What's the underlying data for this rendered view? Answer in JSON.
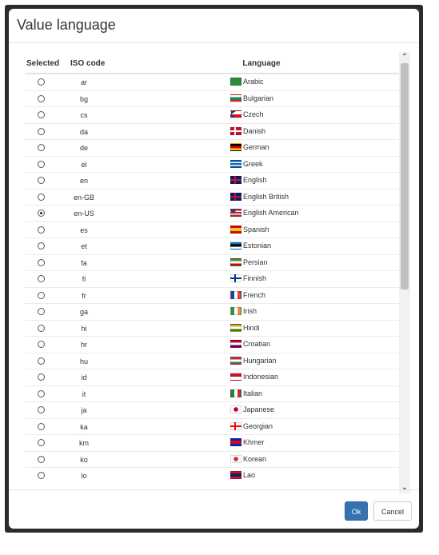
{
  "dialog": {
    "title": "Value language",
    "ok_label": "Ok",
    "cancel_label": "Cancel"
  },
  "table": {
    "headers": {
      "selected": "Selected",
      "iso": "ISO code",
      "language": "Language"
    },
    "selected_iso": "en-US",
    "rows": [
      {
        "iso": "ar",
        "language": "Arabic",
        "flag": "flag-sa-icon",
        "colors": [
          "#2e8b3c",
          "#2e8b3c"
        ]
      },
      {
        "iso": "bg",
        "language": "Bulgarian",
        "flag": "flag-bg-icon",
        "colors": [
          "#ffffff",
          "#00966e",
          "#d62612"
        ]
      },
      {
        "iso": "cs",
        "language": "Czech",
        "flag": "flag-cz-icon",
        "colors": [
          "#ffffff",
          "#d7141a"
        ],
        "tri": "#11457e"
      },
      {
        "iso": "da",
        "language": "Danish",
        "flag": "flag-dk-icon",
        "colors": [
          "#c8102e"
        ],
        "cross": "#ffffff"
      },
      {
        "iso": "de",
        "language": "German",
        "flag": "flag-de-icon",
        "colors": [
          "#000000",
          "#dd0000",
          "#ffce00"
        ]
      },
      {
        "iso": "el",
        "language": "Greek",
        "flag": "flag-gr-icon",
        "colors": [
          "#0d5eaf",
          "#ffffff",
          "#0d5eaf",
          "#ffffff",
          "#0d5eaf"
        ]
      },
      {
        "iso": "en",
        "language": "English",
        "flag": "flag-gb-icon",
        "colors": [
          "#012169"
        ],
        "cross": "#c8102e"
      },
      {
        "iso": "en-GB",
        "language": "English British",
        "flag": "flag-gb-icon",
        "colors": [
          "#012169"
        ],
        "cross": "#c8102e"
      },
      {
        "iso": "en-US",
        "language": "English American",
        "flag": "flag-us-icon",
        "colors": [
          "#b22234",
          "#ffffff",
          "#b22234",
          "#ffffff",
          "#b22234"
        ],
        "canton": "#3c3b6e"
      },
      {
        "iso": "es",
        "language": "Spanish",
        "flag": "flag-es-icon",
        "colors": [
          "#c60b1e",
          "#ffc400",
          "#ffc400",
          "#c60b1e"
        ]
      },
      {
        "iso": "et",
        "language": "Estonian",
        "flag": "flag-ee-icon",
        "colors": [
          "#0072ce",
          "#000000",
          "#ffffff"
        ]
      },
      {
        "iso": "fa",
        "language": "Persian",
        "flag": "flag-ir-icon",
        "colors": [
          "#239f40",
          "#ffffff",
          "#da0000"
        ]
      },
      {
        "iso": "fi",
        "language": "Finnish",
        "flag": "flag-fi-icon",
        "colors": [
          "#ffffff"
        ],
        "cross": "#003580"
      },
      {
        "iso": "fr",
        "language": "French",
        "flag": "flag-fr-icon",
        "vcolors": [
          "#0055a4",
          "#ffffff",
          "#ef4135"
        ]
      },
      {
        "iso": "ga",
        "language": "Irish",
        "flag": "flag-ie-icon",
        "vcolors": [
          "#169b62",
          "#ffffff",
          "#ff883e"
        ]
      },
      {
        "iso": "hi",
        "language": "Hindi",
        "flag": "flag-in-icon",
        "colors": [
          "#ff9933",
          "#ffffff",
          "#138808"
        ]
      },
      {
        "iso": "hr",
        "language": "Croatian",
        "flag": "flag-hr-icon",
        "colors": [
          "#ff0000",
          "#ffffff",
          "#171796"
        ]
      },
      {
        "iso": "hu",
        "language": "Hungarian",
        "flag": "flag-hu-icon",
        "colors": [
          "#ce2939",
          "#ffffff",
          "#477050"
        ]
      },
      {
        "iso": "id",
        "language": "Indonesian",
        "flag": "flag-id-icon",
        "colors": [
          "#ce1126",
          "#ffffff"
        ]
      },
      {
        "iso": "it",
        "language": "Italian",
        "flag": "flag-it-icon",
        "vcolors": [
          "#009246",
          "#ffffff",
          "#ce2b37"
        ]
      },
      {
        "iso": "ja",
        "language": "Japanese",
        "flag": "flag-jp-icon",
        "colors": [
          "#ffffff"
        ],
        "dot": "#bc002d"
      },
      {
        "iso": "ka",
        "language": "Georgian",
        "flag": "flag-ge-icon",
        "colors": [
          "#ffffff"
        ],
        "cross": "#ff0000"
      },
      {
        "iso": "km",
        "language": "Khmer",
        "flag": "flag-kh-icon",
        "colors": [
          "#032ea1",
          "#e00025",
          "#e00025",
          "#032ea1"
        ]
      },
      {
        "iso": "ko",
        "language": "Korean",
        "flag": "flag-kr-icon",
        "colors": [
          "#ffffff"
        ],
        "dot": "#cd2e3a"
      },
      {
        "iso": "lo",
        "language": "Lao",
        "flag": "flag-la-icon",
        "colors": [
          "#ce1126",
          "#002868",
          "#002868",
          "#ce1126"
        ]
      }
    ]
  }
}
